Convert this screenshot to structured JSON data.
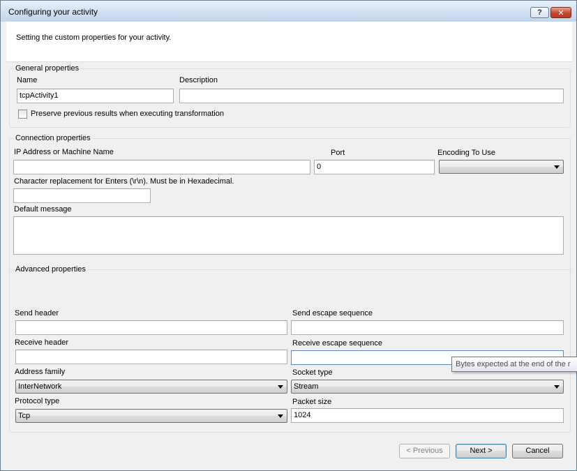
{
  "window": {
    "title": "Configuring your activity"
  },
  "banner": {
    "text": "Setting the custom properties for your activity."
  },
  "general": {
    "legend": "General properties",
    "name_label": "Name",
    "name_value": "tcpActivity1",
    "description_label": "Description",
    "description_value": "",
    "preserve_label": "Preserve previous results when executing transformation",
    "preserve_checked": false
  },
  "connection": {
    "legend": "Connection properties",
    "ip_label": "IP Address or Machine Name",
    "ip_value": "",
    "port_label": "Port",
    "port_value": "0",
    "encoding_label": "Encoding To Use",
    "encoding_value": "",
    "char_repl_label": "Character replacement for Enters (\\r\\n). Must be in Hexadecimal.",
    "char_repl_value": "",
    "default_msg_label": "Default message",
    "default_msg_value": ""
  },
  "advanced": {
    "legend": "Advanced properties",
    "send_header_label": "Send header",
    "send_header_value": "",
    "send_escape_label": "Send escape sequence",
    "send_escape_value": "",
    "receive_header_label": "Receive header",
    "receive_header_value": "",
    "receive_escape_label": "Receive escape sequence",
    "receive_escape_value": "",
    "address_family_label": "Address family",
    "address_family_value": "InterNetwork",
    "socket_type_label": "Socket type",
    "socket_type_value": "Stream",
    "protocol_type_label": "Protocol type",
    "protocol_type_value": "Tcp",
    "packet_size_label": "Packet size",
    "packet_size_value": "1024"
  },
  "tooltip": {
    "text": "Bytes expected at the end of the r"
  },
  "buttons": {
    "previous": "< Previous",
    "next": "Next >",
    "cancel": "Cancel"
  },
  "icons": {
    "help": "?",
    "close": "✕"
  }
}
